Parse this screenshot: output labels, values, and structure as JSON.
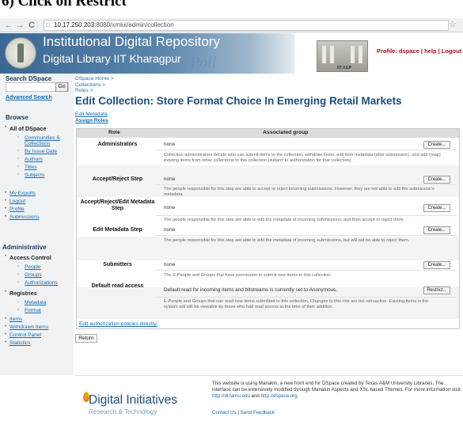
{
  "caption": "6) Click on Restrict",
  "browser": {
    "url_host": "10.17.250.203",
    "url_rest": ":8080/xmlui/admin/collection"
  },
  "header": {
    "title1": "Institutional Digital Repository",
    "title2": "Digital Library IIT Kharagpur",
    "scribble": "Poll",
    "building_sign": "IIT KGP",
    "profile": "Profile: dspace",
    "help": "help",
    "logout": "Logout",
    "sep": " | "
  },
  "sidebar": {
    "search_heading": "Search DSpace",
    "go": "Go",
    "advanced": "Advanced Search",
    "browse_heading": "Browse",
    "all": "All of DSpace",
    "browse_items": [
      "Communities & Collections",
      "By Issue Date",
      "Authors",
      "Titles",
      "Subjects"
    ],
    "my_items": [
      "My Exports",
      "Logout",
      "Profile",
      "Submissions"
    ],
    "admin_heading": "Administrative",
    "access_control": "Access Control",
    "ac_items": [
      "People",
      "Groups",
      "Authorizations"
    ],
    "registries": "Registries",
    "reg_items": [
      "Metadata",
      "Format"
    ],
    "more_items": [
      "Items",
      "Withdrawn Items",
      "Control Panel",
      "Statistics"
    ]
  },
  "main": {
    "crumbs": [
      "DSpace Home >",
      "Collections >",
      "Roles >"
    ],
    "title": "Edit Collection: Store Format Choice In Emerging Retail Markets",
    "edit_metadata": "Edit Metadata",
    "assign_roles": "Assign Roles",
    "col_role": "Role",
    "col_group": "Associated group",
    "rows": [
      {
        "role": "Administrators",
        "group": "none",
        "button": "Create...",
        "desc": "Collection administrators decide who can submit items to the collection, withdraw items, edit item metadata (after submission), and add (map) existing items from other collections to this collection (subject to authorization for that collection)."
      },
      {
        "role": "Accept/Reject Step",
        "group": "none",
        "button": "Create...",
        "desc": "The people responsible for this step are able to accept or reject incoming submissions. However, they are not able to edit the submission's metadata."
      },
      {
        "role": "Accept/Reject/Edit Metadata Step",
        "group": "none",
        "button": "Create...",
        "desc": "The people responsible for this step are able to edit the metadata of incoming submissions, and then accept or reject them."
      },
      {
        "role": "Edit Metadata Step",
        "group": "none",
        "button": "Create...",
        "desc": "The people responsible for this step are able to edit the metadata of incoming submissions, but will not be able to reject them."
      },
      {
        "role": "Submitters",
        "group": "none",
        "button": "Create...",
        "desc": "The E-People and Groups that have permission to submit new items to this collection."
      },
      {
        "role": "Default read access",
        "group": "Default read for incoming items and bitstreams is currently set to Anonymous.",
        "button": "Restrict...",
        "desc": "E-People and Groups that can read new items submitted to this collection. Changes to this role are not retroactive. Existing items in the system will still be viewable by those who had read access at the time of their addition."
      }
    ],
    "edit_auth": "Edit authorization policies directly.",
    "return": "Return"
  },
  "footer": {
    "logo": "Digital Initiatives",
    "logo_sub": "Research & Technology",
    "text1": "This website is using Manakin, a new front end for DSpace created by Texas A&M University Libraries. The",
    "text2": "interface can be extensively modified through Manakin Aspects and XSL based Themes. For more information visit",
    "link1": "http://di.tamu.edu",
    "and": " and ",
    "link2": "http://dspace.org",
    "contact": "Contact Us",
    "sep": " | ",
    "feedback": "Send Feedback"
  }
}
